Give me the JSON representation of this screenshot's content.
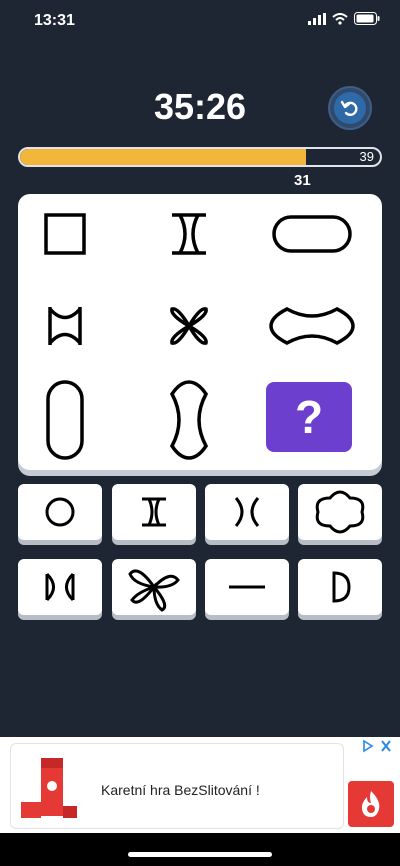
{
  "status_bar": {
    "time": "13:31",
    "icons": [
      "signal-icon",
      "wifi-icon",
      "battery-icon"
    ]
  },
  "game": {
    "timer": "35:26",
    "progress": {
      "current": "31",
      "max": "39",
      "fraction": 0.795
    },
    "undo_icon": "undo-icon",
    "accent_color": "#f2b63a",
    "question_color": "#6d3fcf",
    "question_mark": "?",
    "grid": [
      [
        "square",
        "hourglass-i",
        "stadium-horizontal"
      ],
      [
        "bowtie-vertical-bar",
        "four-petal",
        "scooped-ellipse"
      ],
      [
        "stadium-vertical",
        "scooped-vertical",
        "question"
      ]
    ],
    "options": [
      [
        "circle",
        "serif-i",
        "concave-bars",
        "quatrefoil"
      ],
      [
        "bowtie-horizontal",
        "pinwheel",
        "horizontal-line",
        "half-circle"
      ]
    ]
  },
  "ad": {
    "text": "Karetní hra BezSlitování !",
    "choices_icon": "ad-choices-icon",
    "logo_icon": "flame-logo-icon"
  }
}
